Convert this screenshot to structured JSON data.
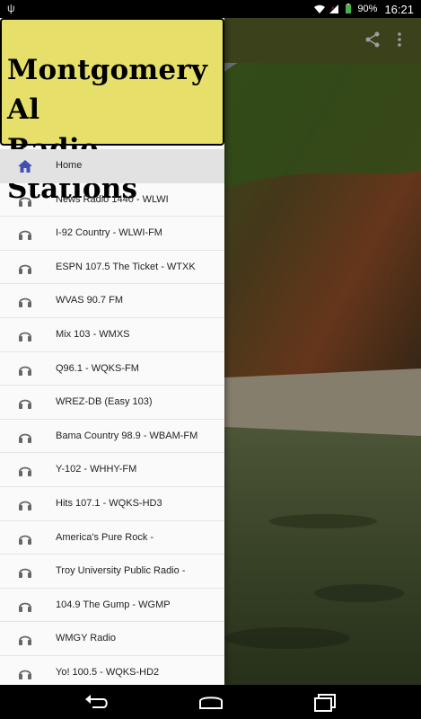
{
  "status_bar": {
    "battery_percent": "90%",
    "time": "16:21"
  },
  "drawer": {
    "title": "Montgomery Al\nRadio Stations",
    "items": [
      {
        "label": "Home",
        "icon": "home-icon",
        "active": true
      },
      {
        "label": "News Radio 1440 - WLWI",
        "icon": "headphones-icon"
      },
      {
        "label": "I-92 Country - WLWI-FM",
        "icon": "headphones-icon"
      },
      {
        "label": "ESPN 107.5 The Ticket - WTXK",
        "icon": "headphones-icon"
      },
      {
        "label": "WVAS 90.7 FM",
        "icon": "headphones-icon"
      },
      {
        "label": "Mix 103 - WMXS",
        "icon": "headphones-icon"
      },
      {
        "label": "Q96.1 - WQKS-FM",
        "icon": "headphones-icon"
      },
      {
        "label": "WREZ-DB (Easy 103)",
        "icon": "headphones-icon"
      },
      {
        "label": "Bama Country 98.9 - WBAM-FM",
        "icon": "headphones-icon"
      },
      {
        "label": "Y-102 - WHHY-FM",
        "icon": "headphones-icon"
      },
      {
        "label": "Hits 107.1 - WQKS-HD3",
        "icon": "headphones-icon"
      },
      {
        "label": "America's Pure Rock -",
        "icon": "headphones-icon"
      },
      {
        "label": "Troy University Public Radio -",
        "icon": "headphones-icon"
      },
      {
        "label": "104.9 The Gump - WGMP",
        "icon": "headphones-icon"
      },
      {
        "label": "WMGY Radio",
        "icon": "headphones-icon"
      },
      {
        "label": "Yo! 100.5 - WQKS-HD2",
        "icon": "headphones-icon"
      }
    ]
  },
  "colors": {
    "drawer_header": "#e6e06a",
    "toolbar": "#5e6a2c",
    "home_icon": "#3f51b5",
    "list_icon": "#666666"
  }
}
